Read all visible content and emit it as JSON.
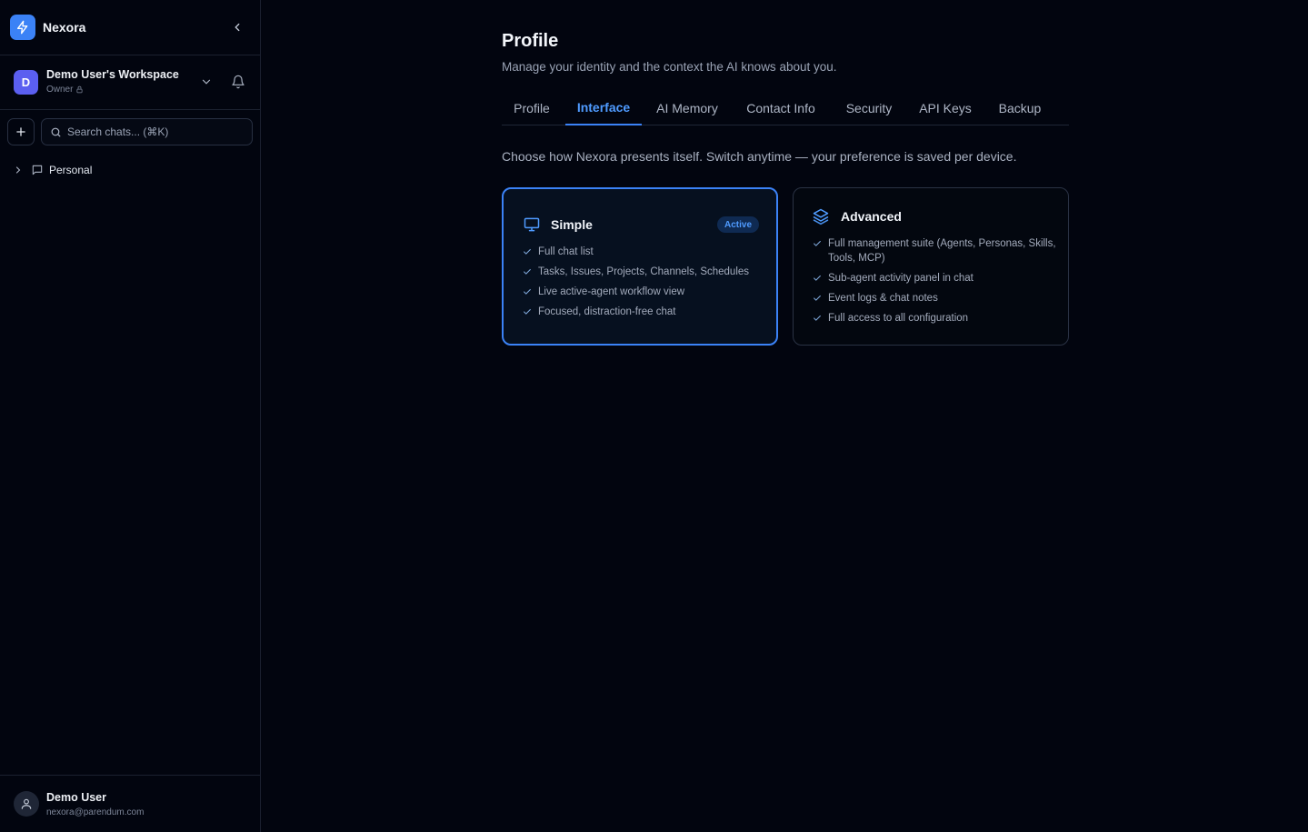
{
  "app": {
    "name": "Nexora",
    "logo_icon": "lightning-icon",
    "accent": "#3b82f6"
  },
  "workspace": {
    "avatar_letter": "D",
    "name": "Demo User's Workspace",
    "role": "Owner"
  },
  "search": {
    "placeholder": "Search chats... (⌘K)"
  },
  "sidebar": {
    "tree": [
      {
        "label": "Personal",
        "icon": "chat-bubble-icon"
      }
    ]
  },
  "user": {
    "name": "Demo User",
    "email": "nexora@parendum.com"
  },
  "page": {
    "title": "Profile",
    "subtitle": "Manage your identity and the context the AI knows about you.",
    "intro": "Choose how Nexora presents itself. Switch anytime — your preference is saved per device."
  },
  "tabs": [
    {
      "label": "Profile",
      "active": false
    },
    {
      "label": "Interface",
      "active": true
    },
    {
      "label": "AI Memory",
      "active": false
    },
    {
      "label": "Contact Info",
      "active": false
    },
    {
      "label": "Security",
      "active": false
    },
    {
      "label": "API Keys",
      "active": false
    },
    {
      "label": "Backup",
      "active": false
    }
  ],
  "modes": {
    "simple": {
      "title": "Simple",
      "badge": "Active",
      "icon": "monitor-icon",
      "features": [
        "Full chat list",
        "Tasks, Issues, Projects, Channels, Schedules",
        "Live active-agent workflow view",
        "Focused, distraction-free chat"
      ]
    },
    "advanced": {
      "title": "Advanced",
      "icon": "layers-icon",
      "features": [
        "Full management suite (Agents, Personas, Skills, Tools, MCP)",
        "Sub-agent activity panel in chat",
        "Event logs & chat notes",
        "Full access to all configuration"
      ]
    }
  }
}
